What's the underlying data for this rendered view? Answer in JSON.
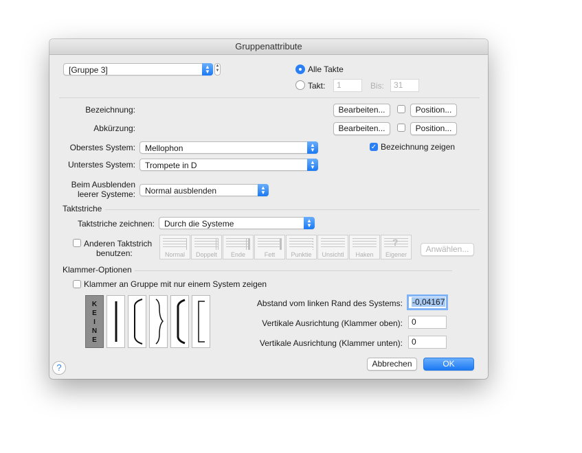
{
  "window": {
    "title": "Gruppenattribute"
  },
  "group_select": {
    "value": "[Gruppe 3]"
  },
  "range": {
    "all_measures_label": "Alle Takte",
    "measure_label": "Takt:",
    "from_value": "1",
    "to_label": "Bis:",
    "to_value": "31"
  },
  "naming": {
    "full_name_label": "Bezeichnung:",
    "abbr_label": "Abkürzung:",
    "edit_label": "Bearbeiten...",
    "position_label": "Position...",
    "show_name_label": "Bezeichnung zeigen"
  },
  "staves": {
    "top_label": "Oberstes System:",
    "top_value": "Mellophon",
    "bottom_label": "Unterstes System:",
    "bottom_value": "Trompete in D",
    "hide_label_1": "Beim Ausblenden",
    "hide_label_2": "leerer Systeme:",
    "hide_value": "Normal ausblenden"
  },
  "barlines": {
    "section_label": "Taktstriche",
    "draw_label": "Taktstriche zeichnen:",
    "draw_value": "Durch die Systeme",
    "other_label_1": "Anderen Taktstrich",
    "other_label_2": "benutzen:",
    "types": [
      "Normal",
      "Doppelt",
      "Ende",
      "Fett",
      "Punktie",
      "Unsichtl",
      "Haken",
      "Eigener"
    ],
    "select_label": "Anwählen..."
  },
  "brackets": {
    "section_label": "Klammer-Optionen",
    "single_staff_label": "Klammer an Gruppe mit nur einem System zeigen",
    "none_letters": [
      "K",
      "E",
      "I",
      "N",
      "E"
    ],
    "left_offset_label": "Abstand vom linken Rand des Systems:",
    "left_offset_value": "-0,04167",
    "top_label": "Vertikale Ausrichtung (Klammer oben):",
    "top_value": "0",
    "bottom_label": "Vertikale Ausrichtung (Klammer unten):",
    "bottom_value": "0"
  },
  "footer": {
    "cancel_label": "Abbrechen",
    "ok_label": "OK",
    "help_label": "?"
  },
  "colors": {
    "accent": "#2b7ff5",
    "window_bg": "#ececec"
  }
}
